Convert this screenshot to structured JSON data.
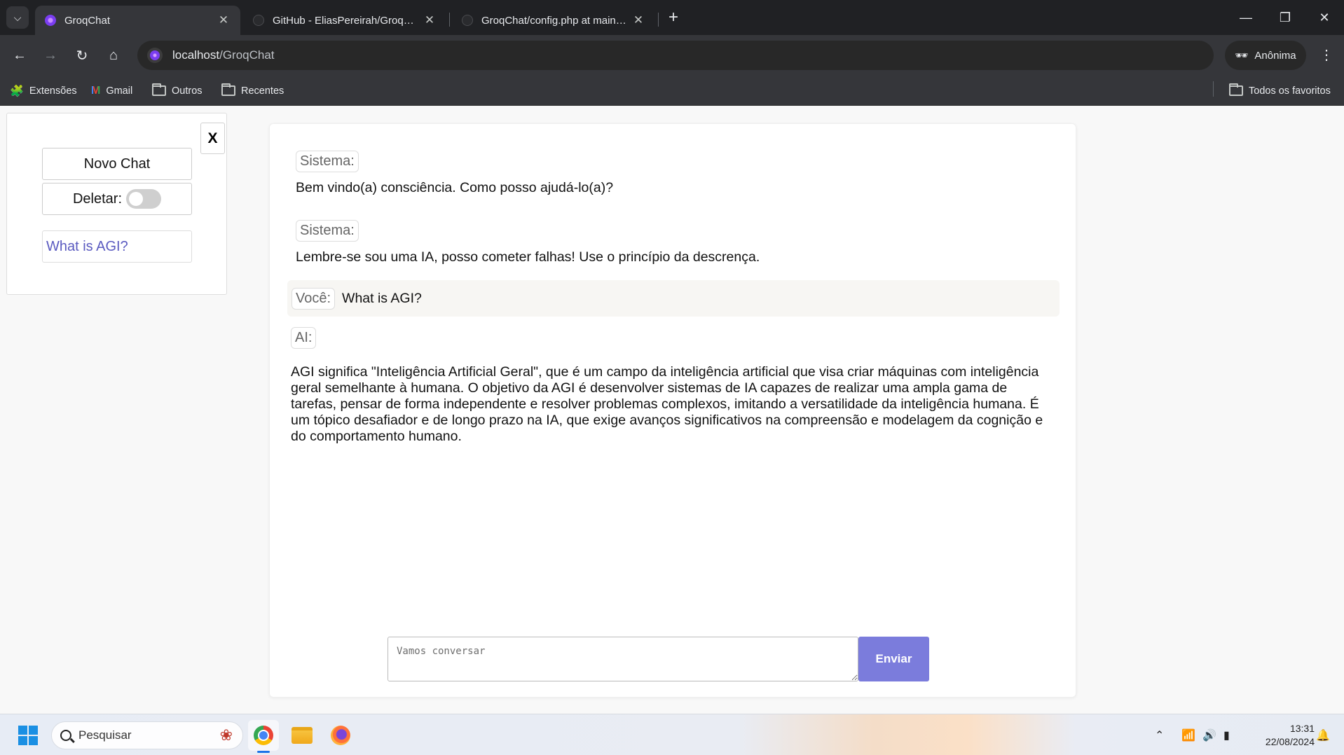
{
  "browser": {
    "tabs": [
      {
        "title": "GroqChat",
        "active": true
      },
      {
        "title": "GitHub - EliasPereirah/GroqChat",
        "active": false
      },
      {
        "title": "GroqChat/config.php at main · EliasPereirah/GroqChat",
        "active": false
      }
    ],
    "url_host": "localhost",
    "url_path": "/GroqChat",
    "incognito_label": "Anônima",
    "bookmarks": [
      "Extensões",
      "Gmail",
      "Outros",
      "Recentes"
    ],
    "all_bookmarks_label": "Todos os favoritos"
  },
  "sidebar": {
    "close_label": "X",
    "new_chat_label": "Novo Chat",
    "delete_label": "Deletar:",
    "delete_enabled": false,
    "history": [
      "What is AGI?"
    ]
  },
  "chat": {
    "messages": [
      {
        "role": "Sistema:",
        "text": "Bem vindo(a) consciência. Como posso ajudá-lo(a)?"
      },
      {
        "role": "Sistema:",
        "text": "Lembre-se sou uma IA, posso cometer falhas! Use o princípio da descrença."
      },
      {
        "role": "Você:",
        "text": "What is AGI?"
      },
      {
        "role": "AI:",
        "text": "AGI significa \"Inteligência Artificial Geral\", que é um campo da inteligência artificial que visa criar máquinas com inteligência geral semelhante à humana. O objetivo da AGI é desenvolver sistemas de IA capazes de realizar uma ampla gama de tarefas, pensar de forma independente e resolver problemas complexos, imitando a versatilidade da inteligência humana. É um tópico desafiador e de longo prazo na IA, que exige avanços significativos na compreensão e modelagem da cognição e do comportamento humano."
      }
    ],
    "input_placeholder": "Vamos conversar",
    "input_value": "",
    "send_label": "Enviar"
  },
  "taskbar": {
    "search_placeholder": "Pesquisar",
    "time": "13:31",
    "date": "22/08/2024"
  },
  "colors": {
    "accent": "#7b7cdc",
    "history_link": "#5a5ac0",
    "chrome_dark": "#202124"
  }
}
